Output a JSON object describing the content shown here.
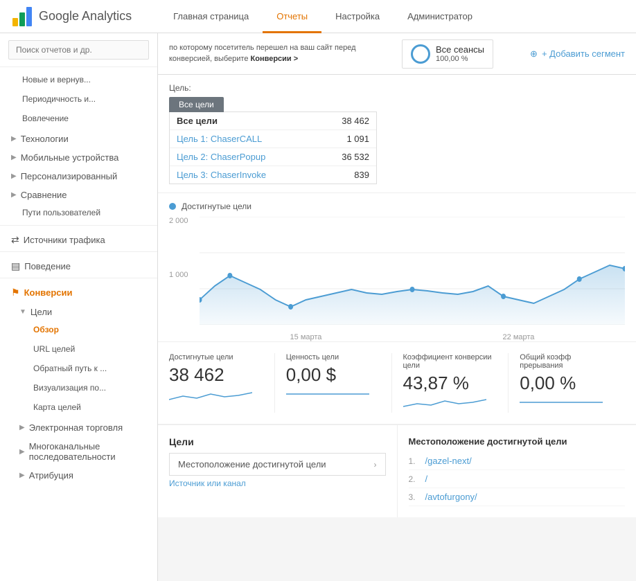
{
  "header": {
    "logo_text": "Google Analytics",
    "nav": [
      {
        "label": "Главная страница",
        "active": false
      },
      {
        "label": "Отчеты",
        "active": true
      },
      {
        "label": "Настройка",
        "active": false
      },
      {
        "label": "Администратор",
        "active": false
      }
    ]
  },
  "sidebar": {
    "search_placeholder": "Поиск отчетов и др.",
    "items": [
      {
        "label": "Новые и вернув...",
        "type": "sub",
        "active": false
      },
      {
        "label": "Периодичность и...",
        "type": "sub",
        "active": false
      },
      {
        "label": "Вовлечение",
        "type": "sub",
        "active": false
      },
      {
        "label": "▶ Технологии",
        "type": "group",
        "active": false
      },
      {
        "label": "▶ Мобильные устройства",
        "type": "group",
        "active": false
      },
      {
        "label": "▶ Персонализированный",
        "type": "group",
        "active": false
      },
      {
        "label": "▶ Сравнение",
        "type": "group",
        "active": false
      },
      {
        "label": "Пути пользователей",
        "type": "sub",
        "active": false
      },
      {
        "label": "Источники трафика",
        "type": "main",
        "active": false
      },
      {
        "label": "Поведение",
        "type": "main",
        "active": false
      },
      {
        "label": "Конверсии",
        "type": "main-active",
        "active": true
      },
      {
        "label": "▼ Цели",
        "type": "sub-group",
        "active": false
      },
      {
        "label": "Обзор",
        "type": "sub-sub-active",
        "active": true
      },
      {
        "label": "URL целей",
        "type": "sub-sub",
        "active": false
      },
      {
        "label": "Обратный путь к ...",
        "type": "sub-sub",
        "active": false
      },
      {
        "label": "Визуализация по...",
        "type": "sub-sub",
        "active": false
      },
      {
        "label": "Карта целей",
        "type": "sub-sub",
        "active": false
      },
      {
        "label": "▶ Электронная торговля",
        "type": "sub-group",
        "active": false
      },
      {
        "label": "▶ Многоканальные последовательности",
        "type": "sub-group",
        "active": false
      },
      {
        "label": "▶ Атрибуция",
        "type": "sub-group",
        "active": false
      }
    ]
  },
  "segment": {
    "info_text": "по которому посетитель перешел на ваш сайт перед конверсией, выберите",
    "info_link": "Конверсии >",
    "all_sessions_label": "Все сеансы",
    "all_sessions_pct": "100,00 %",
    "add_segment_label": "+ Добавить сегмент"
  },
  "goals": {
    "label": "Цель:",
    "tab_label": "Все цели",
    "rows": [
      {
        "name": "Все цели",
        "value": "38 462",
        "bold": true,
        "link": false
      },
      {
        "name": "Цель 1: ChaserCALL",
        "value": "1 091",
        "bold": false,
        "link": true
      },
      {
        "name": "Цель 2: ChaserPopup",
        "value": "36 532",
        "bold": false,
        "link": true
      },
      {
        "name": "Цель 3: ChaserInvoke",
        "value": "839",
        "bold": false,
        "link": true
      }
    ]
  },
  "chart": {
    "legend_label": "Достигнутые цели",
    "y_labels": [
      "2 000",
      "",
      "1 000",
      ""
    ],
    "x_labels": [
      "15 марта",
      "22 марта"
    ],
    "data_points": [
      35,
      65,
      80,
      70,
      60,
      40,
      30,
      40,
      45,
      50,
      55,
      50,
      48,
      52,
      55,
      53,
      50,
      48,
      52,
      60,
      45,
      40,
      35,
      45,
      55,
      70,
      80,
      90
    ]
  },
  "stats": [
    {
      "label": "Достигнутые цели",
      "value": "38 462"
    },
    {
      "label": "Ценность цели",
      "value": "0,00 $"
    },
    {
      "label": "Коэффициент конверсии цели",
      "value": "43,87 %"
    },
    {
      "label": "Общий коэфф прерывания",
      "value": "0,00 %"
    }
  ],
  "goals_links": {
    "title": "Цели",
    "rows": [
      {
        "label": "Местоположение достигнутой цели"
      },
      {
        "label": "Источник или канал"
      }
    ]
  },
  "location": {
    "title": "Местоположение достигнутой цели",
    "items": [
      {
        "num": "1.",
        "label": "/gazel-next/"
      },
      {
        "num": "2.",
        "label": "/"
      },
      {
        "num": "3.",
        "label": "/avtofurgony/"
      }
    ]
  }
}
